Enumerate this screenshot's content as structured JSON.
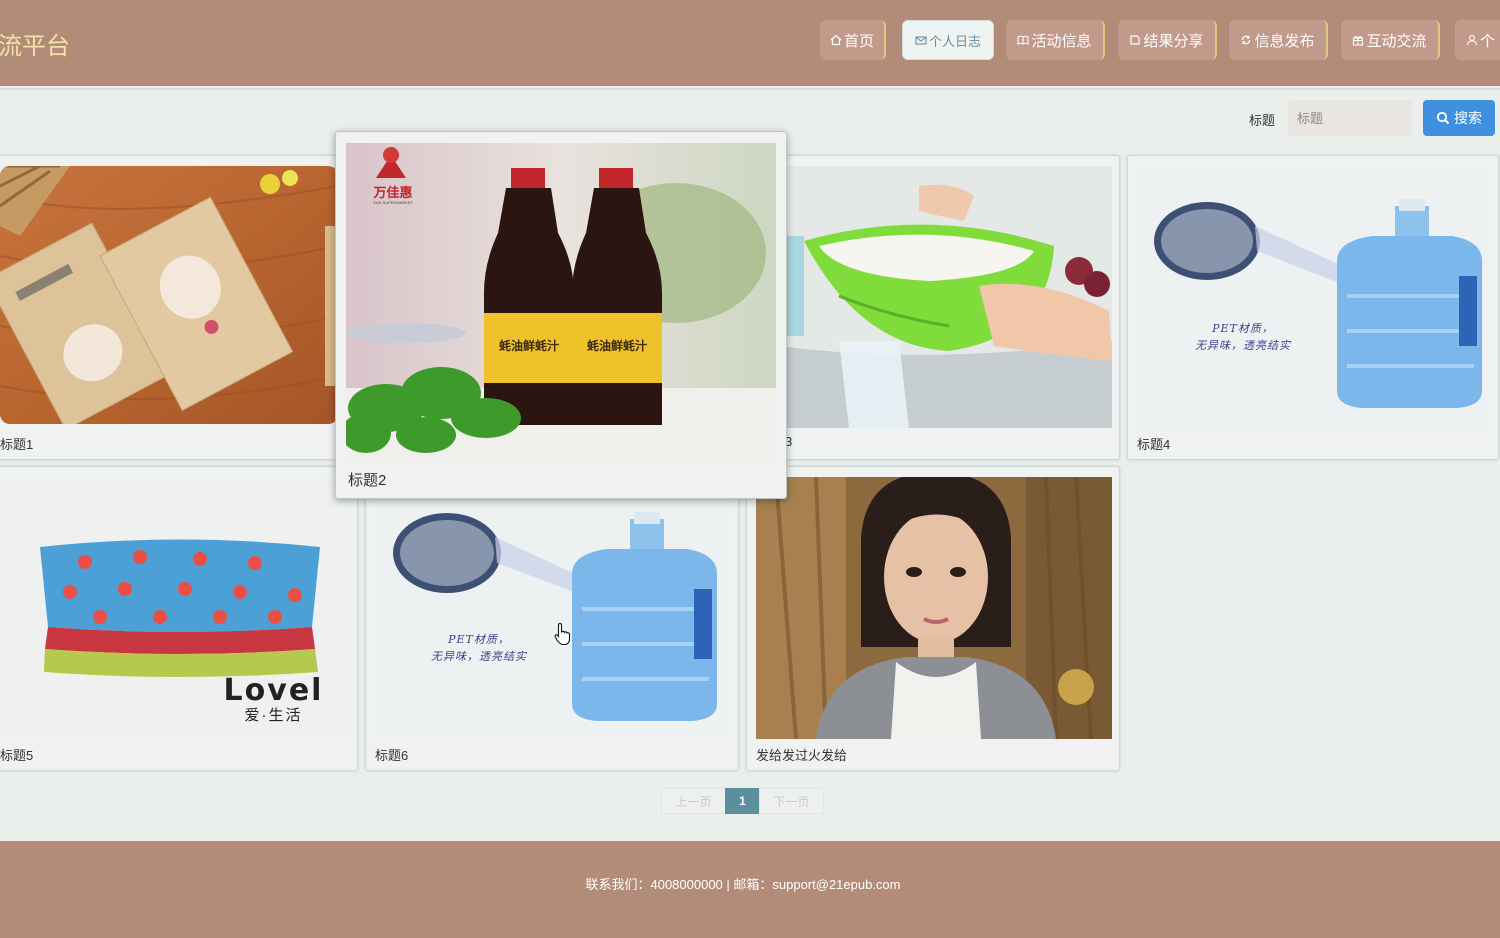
{
  "header": {
    "logo": "流平台",
    "nav": [
      {
        "label": "首页",
        "icon": "home-icon"
      },
      {
        "label": "个人日志",
        "icon": "mail-icon",
        "active": true
      },
      {
        "label": "活动信息",
        "icon": "book-icon"
      },
      {
        "label": "结果分享",
        "icon": "share-icon"
      },
      {
        "label": "信息发布",
        "icon": "refresh-icon"
      },
      {
        "label": "互动交流",
        "icon": "gift-icon"
      },
      {
        "label": "个",
        "icon": "user-icon"
      }
    ]
  },
  "search": {
    "label": "标题",
    "placeholder": "标题",
    "button": "搜索"
  },
  "cards": [
    {
      "caption": "标题1",
      "image": "toothpick-boxes"
    },
    {
      "caption": "标题2",
      "image": "oyster-sauce-bottles"
    },
    {
      "caption": "3",
      "image": "rice-washing-basket"
    },
    {
      "caption": "标题4",
      "image": "water-jug-pet"
    },
    {
      "caption": "标题5",
      "image": "folded-towels-lovel"
    },
    {
      "caption": "标题6",
      "image": "water-jug-pet"
    },
    {
      "caption": "发给发过火发给",
      "image": "woman-portrait"
    }
  ],
  "image_text": {
    "brand_cn": "万佳惠",
    "brand_en": "SUN SUPERMARKET",
    "bottle_label": "蚝油鲜蚝汁",
    "pet_line1": "PET材质，",
    "pet_line2": "无异味，透亮结实",
    "lovel_brand": "Lovel",
    "lovel_slogan": "爱·生活"
  },
  "pagination": {
    "prev": "上一页",
    "current": "1",
    "next": "下一页"
  },
  "footer": {
    "text": "联系我们：4008000000 | 邮箱：support@21epub.com"
  },
  "colors": {
    "header_bg": "#b38b79",
    "logo_text": "#f4e2a8",
    "nav_bg": "#c29a8b",
    "nav_border": "#e2c77f",
    "search_button": "#3f90df",
    "page_bg": "#eaefec",
    "pager_active": "#5a8f9b"
  }
}
